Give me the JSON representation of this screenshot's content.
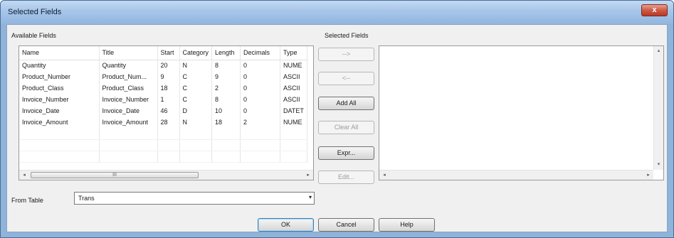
{
  "window": {
    "title": "Selected Fields",
    "close_glyph": "x"
  },
  "available": {
    "label": "Available Fields",
    "columns": [
      "Name",
      "Title",
      "Start",
      "Category",
      "Length",
      "Decimals",
      "Type"
    ],
    "rows": [
      [
        "Quantity",
        "Quantity",
        "20",
        "N",
        "8",
        "0",
        "NUME"
      ],
      [
        "Product_Number",
        "Product_Num...",
        "9",
        "C",
        "9",
        "0",
        "ASCII"
      ],
      [
        "Product_Class",
        "Product_Class",
        "18",
        "C",
        "2",
        "0",
        "ASCII"
      ],
      [
        "Invoice_Number",
        "Invoice_Number",
        "1",
        "C",
        "8",
        "0",
        "ASCII"
      ],
      [
        "Invoice_Date",
        "Invoice_Date",
        "46",
        "D",
        "10",
        "0",
        "DATET"
      ],
      [
        "Invoice_Amount",
        "Invoice_Amount",
        "28",
        "N",
        "18",
        "2",
        "NUME"
      ]
    ],
    "scroll_left_glyph": "◂",
    "scroll_right_glyph": "▸",
    "scroll_grip": "III"
  },
  "selected": {
    "label": "Selected Fields",
    "scroll_up_glyph": "▴",
    "scroll_down_glyph": "▾",
    "scroll_left_glyph": "◂",
    "scroll_right_glyph": "▸"
  },
  "buttons": {
    "add": "-->",
    "remove": "<--",
    "add_all": "Add All",
    "clear_all": "Clear All",
    "expr": "Expr...",
    "edit": "Edit..."
  },
  "from_table": {
    "label": "From Table",
    "value": "Trans",
    "arrow": "▾"
  },
  "footer": {
    "ok": "OK",
    "cancel": "Cancel",
    "help": "Help"
  }
}
